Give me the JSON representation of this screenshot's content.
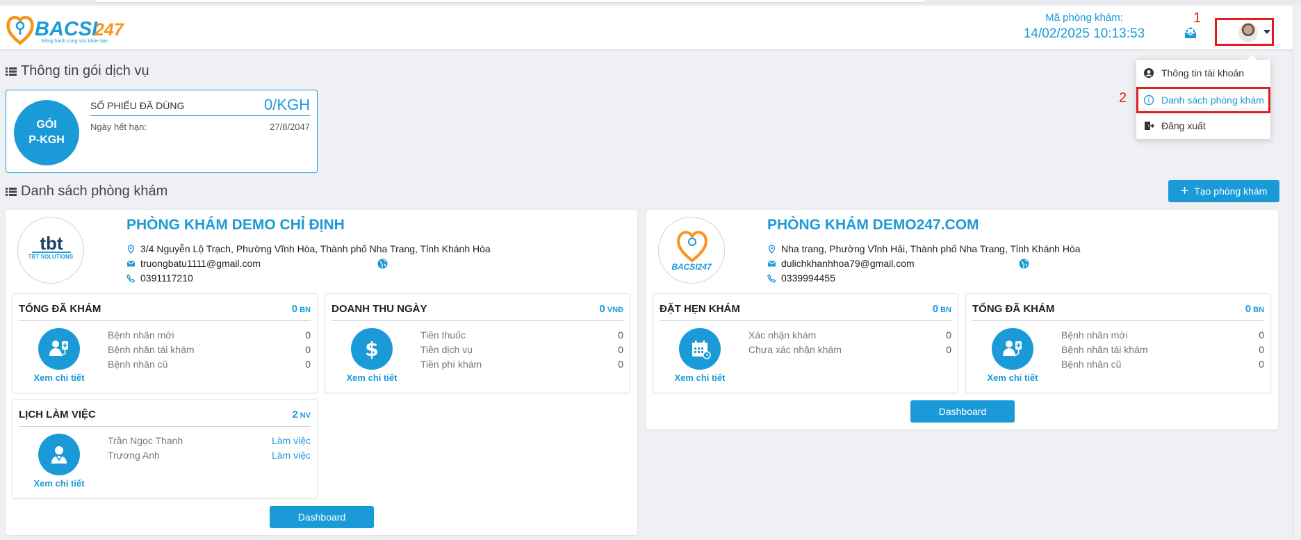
{
  "header": {
    "logo_text": "BACSI247",
    "logo_slogan": "Đồng hành cùng sức khỏe bạn",
    "clinic_code_label": "Mã phòng khám:",
    "datetime": "14/02/2025 10:13:53",
    "annotation_1": "1"
  },
  "user_menu": {
    "annotation_2": "2",
    "items": [
      {
        "label": "Thông tin tài khoản",
        "icon": "user-circle-icon"
      },
      {
        "label": "Danh sách phòng khám",
        "icon": "info-icon"
      },
      {
        "label": "Đăng xuất",
        "icon": "logout-icon"
      }
    ]
  },
  "package_section": {
    "title": "Thông tin gói dịch vụ",
    "package_line1": "GÓI",
    "package_line2": "P-KGH",
    "used_label": "SỐ PHIẾU ĐÃ DÙNG",
    "used_value": "0/KGH",
    "expiry_label": "Ngày hết hạn:",
    "expiry_value": "27/8/2047"
  },
  "clinic_section": {
    "title": "Danh sách phòng khám",
    "create_button": "Tạo phòng khám"
  },
  "clinics": [
    {
      "name": "PHÒNG KHÁM DEMO CHỈ ĐỊNH",
      "logo_text": "TBT SOLUTIONS",
      "address": "3/4 Nguyễn Lộ Trạch, Phường Vĩnh Hòa, Thành phố Nha Trang, Tỉnh Khánh Hòa",
      "email": "truongbatu1111@gmail.com",
      "phone": "0391117210",
      "stats": [
        {
          "title": "TỔNG ĐÃ KHÁM",
          "value": "0",
          "unit": "BN",
          "link": "Xem chi tiết",
          "rows": [
            {
              "label": "Bệnh nhân mới",
              "value": "0"
            },
            {
              "label": "Bệnh nhân tái khám",
              "value": "0"
            },
            {
              "label": "Bệnh nhân cũ",
              "value": "0"
            }
          ]
        },
        {
          "title": "DOANH THU NGÀY",
          "value": "0",
          "unit": "VNĐ",
          "link": "Xem chi tiết",
          "rows": [
            {
              "label": "Tiền thuốc",
              "value": "0"
            },
            {
              "label": "Tiền dịch vụ",
              "value": "0"
            },
            {
              "label": "Tiền phí khám",
              "value": "0"
            }
          ]
        },
        {
          "title": "LỊCH LÀM VIỆC",
          "value": "2",
          "unit": "NV",
          "link": "Xem chi tiết",
          "rows": [
            {
              "label": "Trần Ngọc Thanh",
              "value": "Làm việc"
            },
            {
              "label": "Trương Anh",
              "value": "Làm việc"
            }
          ]
        }
      ],
      "dashboard": "Dashboard"
    },
    {
      "name": "PHÒNG KHÁM DEMO247.COM",
      "logo_text": "BACSI247",
      "address": "Nha trang, Phường Vĩnh Hải, Thành phố Nha Trang, Tỉnh Khánh Hòa",
      "email": "dulichkhanhhoa79@gmail.com",
      "phone": "0339994455",
      "stats": [
        {
          "title": "ĐẶT HẸN KHÁM",
          "value": "0",
          "unit": "BN",
          "link": "Xem chi tiết",
          "rows": [
            {
              "label": "Xác nhận khám",
              "value": "0"
            },
            {
              "label": "Chưa xác nhận khám",
              "value": "0"
            }
          ]
        },
        {
          "title": "TỔNG ĐÃ KHÁM",
          "value": "0",
          "unit": "BN",
          "link": "Xem chi tiết",
          "rows": [
            {
              "label": "Bệnh nhân mới",
              "value": "0"
            },
            {
              "label": "Bệnh nhân tái khám",
              "value": "0"
            },
            {
              "label": "Bệnh nhân cũ",
              "value": "0"
            }
          ]
        }
      ],
      "dashboard": "Dashboard"
    }
  ],
  "colors": {
    "primary": "#1b9ad8",
    "logo_orange": "#f7941d",
    "annotation_red": "#e01e1e"
  }
}
